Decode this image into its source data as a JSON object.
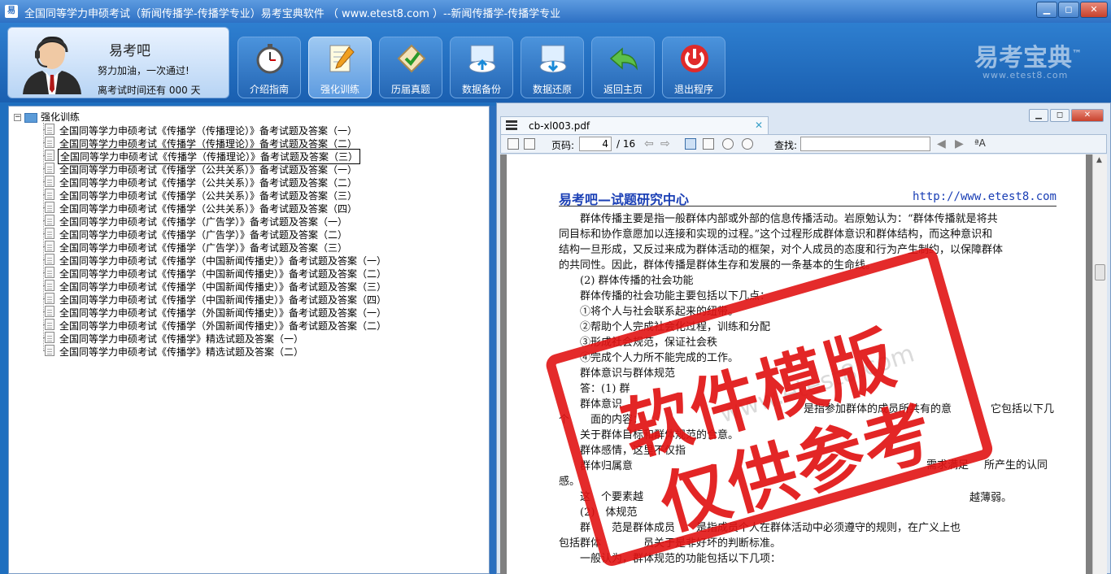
{
  "window": {
    "title": "全国同等学力申硕考试（新闻传播学-传播学专业）易考宝典软件 （ www.etest8.com ）--新闻传播学-传播学专业",
    "icon_text": "易",
    "min_icon": "minimize-icon",
    "max_icon": "maximize-icon",
    "close_icon": "close-icon"
  },
  "user": {
    "name": "易考吧",
    "slogan": "努力加油，一次通过!",
    "countdown": "离考试时间还有 000 天"
  },
  "toolbar": {
    "buttons": [
      {
        "label": "介绍指南",
        "icon": "stopwatch-icon"
      },
      {
        "label": "强化训练",
        "icon": "notepad-icon",
        "active": true
      },
      {
        "label": "历届真题",
        "icon": "checklist-icon"
      },
      {
        "label": "数据备份",
        "icon": "cloud-upload-icon"
      },
      {
        "label": "数据还原",
        "icon": "cloud-download-icon"
      },
      {
        "label": "返回主页",
        "icon": "back-arrow-icon"
      },
      {
        "label": "退出程序",
        "icon": "power-icon"
      }
    ]
  },
  "brand": {
    "name": "易考宝典",
    "url": "www.etest8.com",
    "trademark": "™"
  },
  "tree": {
    "root": "强化训练",
    "items": [
      "全国同等学力申硕考试《传播学（传播理论）》备考试题及答案（一）",
      "全国同等学力申硕考试《传播学（传播理论）》备考试题及答案（二）",
      "全国同等学力申硕考试《传播学（传播理论）》备考试题及答案（三）",
      "全国同等学力申硕考试《传播学（公共关系）》备考试题及答案（一）",
      "全国同等学力申硕考试《传播学（公共关系）》备考试题及答案（二）",
      "全国同等学力申硕考试《传播学（公共关系）》备考试题及答案（三）",
      "全国同等学力申硕考试《传播学（公共关系）》备考试题及答案（四）",
      "全国同等学力申硕考试《传播学（广告学）》备考试题及答案（一）",
      "全国同等学力申硕考试《传播学（广告学）》备考试题及答案（二）",
      "全国同等学力申硕考试《传播学（广告学）》备考试题及答案（三）",
      "全国同等学力申硕考试《传播学（中国新闻传播史）》备考试题及答案（一）",
      "全国同等学力申硕考试《传播学（中国新闻传播史）》备考试题及答案（二）",
      "全国同等学力申硕考试《传播学（中国新闻传播史）》备考试题及答案（三）",
      "全国同等学力申硕考试《传播学（中国新闻传播史）》备考试题及答案（四）",
      "全国同等学力申硕考试《传播学（外国新闻传播史）》备考试题及答案（一）",
      "全国同等学力申硕考试《传播学（外国新闻传播史）》备考试题及答案（二）",
      "全国同等学力申硕考试《传播学》精选试题及答案（一）",
      "全国同等学力申硕考试《传播学》精选试题及答案（二）"
    ],
    "selected_index": 2
  },
  "pdf": {
    "filename": "cb-xl003.pdf",
    "page_label": "页码:",
    "page_current": "4",
    "page_total": "/ 16",
    "find_label": "查找:",
    "header_left": "易考吧—试题研究中心",
    "header_right": "http://www.etest8.com",
    "lines": [
      "　　群体传播主要是指一般群体内部或外部的信息传播活动。岩原勉认为：“群体传播就是将共",
      "同目标和协作意愿加以连接和实现的过程。”这个过程形成群体意识和群体结构，而这种意识和",
      "结构一旦形成，又反过来成为群体活动的框架，对个人成员的态度和行为产生制约，以保障群体",
      "的共同性。因此，群体传播是群体生存和发展的一条基本的生命线。",
      "　　(2) 群体传播的社会功能",
      "　　群体传播的社会功能主要包括以下几点：",
      "　　①将个人与社会联系起来的纽带。",
      "　　②帮助个人完成社会化过程，训练和分配",
      "　　③形成社会规范，保证社会秩",
      "　　④完成个人力所不能完成的工作。",
      "　　群体意识与群体规范",
      "　　答：(1) 群",
      "　　群体意识",
      "个　　面的内容：",
      "　　关于群体目标和群体规范的合意。",
      "　　群体感情，这里不仅指",
      "　　群体归属意",
      "感。",
      "　　这　个要素越",
      "　　(2)　体规范",
      "　　群　　范是群体成员　　是指成员个人在群体活动中必须遵守的规则，在广义上也",
      "包括群体　　　　员关于是非好坏的判断标准。",
      "　　一般认为，群体规范的功能包括以下几项："
    ],
    "fragments": {
      "f1": "是指参加群体的成员所共有的意",
      "f2": "它包括以下几",
      "f3": "需求满足",
      "f4": "所产生的认同",
      "f5": "越薄弱。"
    }
  },
  "watermark": {
    "line1": "软件模版",
    "line2": "仅供参考",
    "site": "www.etest8.com"
  }
}
